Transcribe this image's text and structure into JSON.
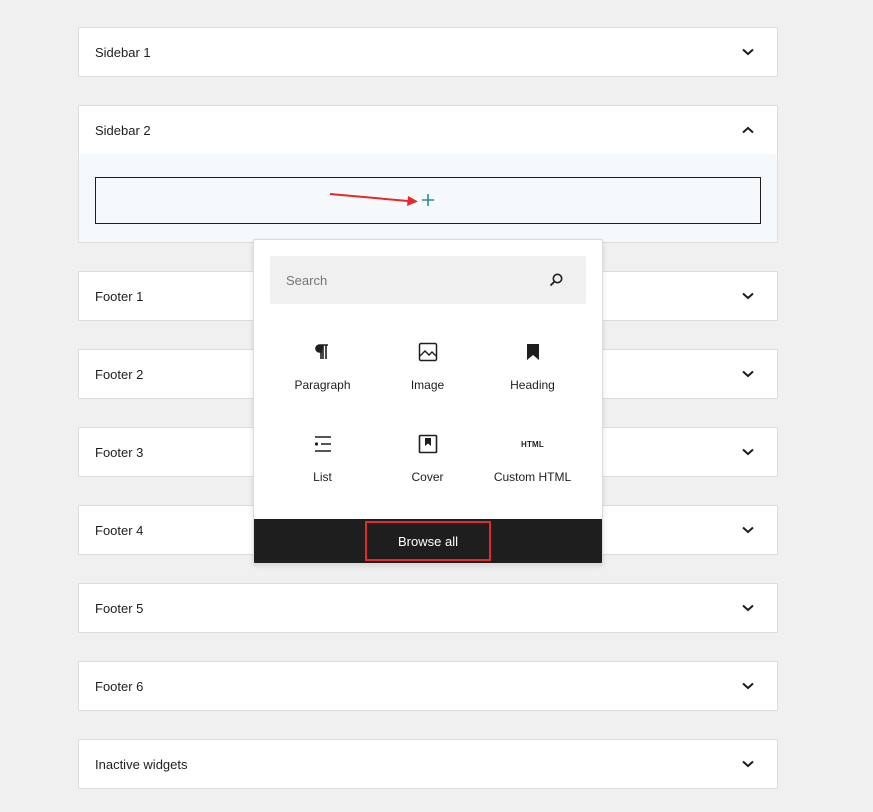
{
  "areas": [
    {
      "title": "Sidebar 1",
      "expanded": false
    },
    {
      "title": "Sidebar 2",
      "expanded": true
    },
    {
      "title": "Footer 1",
      "expanded": false
    },
    {
      "title": "Footer 2",
      "expanded": false
    },
    {
      "title": "Footer 3",
      "expanded": false
    },
    {
      "title": "Footer 4",
      "expanded": false
    },
    {
      "title": "Footer 5",
      "expanded": false
    },
    {
      "title": "Footer 6",
      "expanded": false
    },
    {
      "title": "Inactive widgets",
      "expanded": false
    }
  ],
  "inserter": {
    "search_placeholder": "Search",
    "blocks": [
      {
        "label": "Paragraph",
        "icon": "paragraph-icon"
      },
      {
        "label": "Image",
        "icon": "image-icon"
      },
      {
        "label": "Heading",
        "icon": "heading-icon"
      },
      {
        "label": "List",
        "icon": "list-icon"
      },
      {
        "label": "Cover",
        "icon": "cover-icon"
      },
      {
        "label": "Custom HTML",
        "icon": "html-icon",
        "icon_text": "HTML"
      }
    ],
    "browse_all_label": "Browse all"
  },
  "colors": {
    "accent": "#2a8c8c",
    "highlight": "#e22a2a",
    "footer": "#1e1e1e"
  }
}
